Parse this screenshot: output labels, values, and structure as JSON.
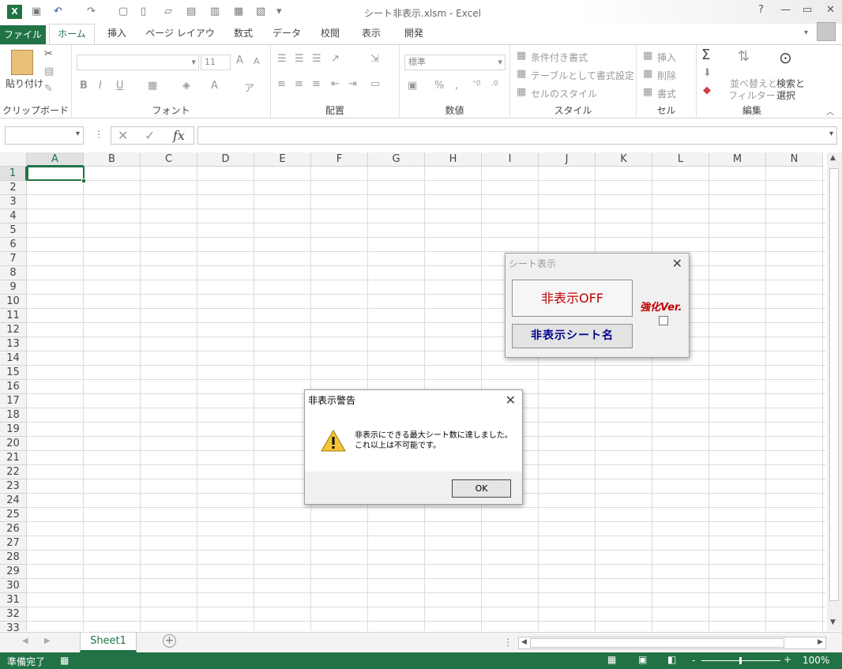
{
  "window": {
    "title": "シート非表示.xlsm - Excel",
    "help": "?",
    "minimize": "—",
    "restore": "▭",
    "close": "✕"
  },
  "tabs": [
    {
      "label": "ファイル"
    },
    {
      "label": "ホーム"
    },
    {
      "label": "挿入"
    },
    {
      "label": "ページ レイアウト"
    },
    {
      "label": "数式"
    },
    {
      "label": "データ"
    },
    {
      "label": "校閲"
    },
    {
      "label": "表示"
    },
    {
      "label": "開発"
    }
  ],
  "ribbon": {
    "clipboard": {
      "paste": "貼り付け",
      "label": "クリップボード"
    },
    "font": {
      "size": "11",
      "bold": "B",
      "italic": "I",
      "underline": "U",
      "grow": "A",
      "shrink": "A",
      "fontcolor": "A",
      "label": "フォント"
    },
    "alignment": {
      "label": "配置"
    },
    "number": {
      "format": "標準",
      "percent": "%",
      "comma": ",",
      "label": "数値"
    },
    "styles": {
      "conditional": "条件付き書式",
      "table": "テーブルとして書式設定",
      "cell": "セルのスタイル",
      "label": "スタイル"
    },
    "cells": {
      "insert": "挿入",
      "delete": "削除",
      "format": "書式",
      "label": "セル"
    },
    "editing": {
      "sigma": "Σ",
      "sort1": "並べ替えと",
      "sort2": "フィルター",
      "find1": "検索と",
      "find2": "選択",
      "label": "編集"
    }
  },
  "formula_bar": {
    "fx": "fx",
    "cancel": "✕",
    "enter": "✓"
  },
  "columns": [
    "A",
    "B",
    "C",
    "D",
    "E",
    "F",
    "G",
    "H",
    "I",
    "J",
    "K",
    "L",
    "M",
    "N"
  ],
  "rows": [
    "1",
    "2",
    "3",
    "4",
    "5",
    "6",
    "7",
    "8",
    "9",
    "10",
    "11",
    "12",
    "13",
    "14",
    "15",
    "16",
    "17",
    "18",
    "19",
    "20",
    "21",
    "22",
    "23",
    "24",
    "25",
    "26",
    "27",
    "28",
    "29",
    "30",
    "31",
    "32",
    "33"
  ],
  "sheet_tabs": {
    "active": "Sheet1",
    "add": "+"
  },
  "status": {
    "ready": "準備完了",
    "zoom": "100%",
    "minus": "-",
    "plus": "+"
  },
  "userform": {
    "title": "シート表示",
    "button_off": "非表示OFF",
    "button_names": "非表示シート名",
    "ver_label": "強化Ver."
  },
  "msgbox": {
    "title": "非表示警告",
    "line1": "非表示にできる最大シート数に達しました。",
    "line2": "これ以上は不可能です。",
    "ok": "OK"
  }
}
